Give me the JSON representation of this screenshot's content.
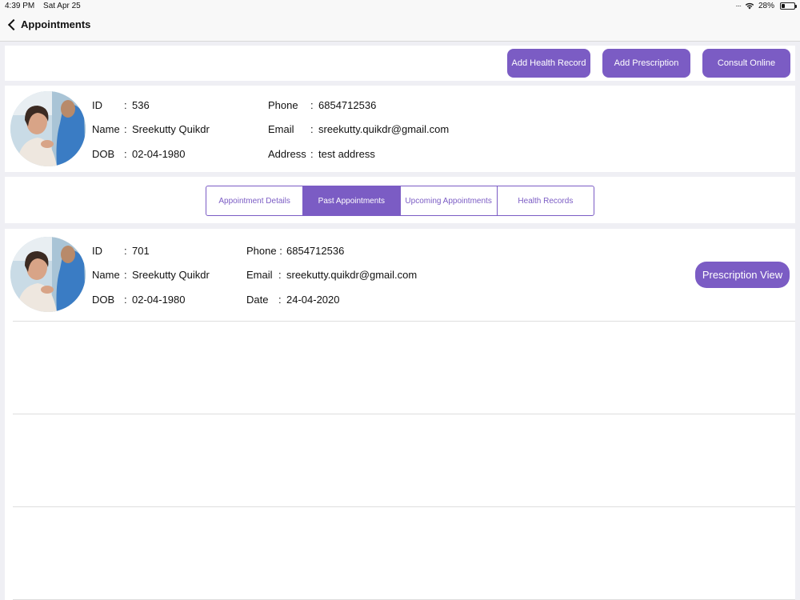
{
  "status_bar": {
    "time": "4:39 PM",
    "date": "Sat Apr 25",
    "battery": "28%",
    "battery_level": 0.28
  },
  "nav": {
    "back_label": "Appointments"
  },
  "actions": {
    "add_health_record": "Add Health Record",
    "add_prescription": "Add Prescription",
    "consult_online": "Consult Online"
  },
  "patient": {
    "id_label": "ID",
    "id_sep": ":",
    "id": "536",
    "name_label": "Name",
    "name_sep": ":",
    "name": "Sreekutty Quikdr",
    "dob_label": "DOB",
    "dob_sep": ":",
    "dob": "02-04-1980",
    "phone_label": "Phone",
    "phone_sep": ":",
    "phone": "6854712536",
    "email_label": "Email",
    "email_sep": ":",
    "email": "sreekutty.quikdr@gmail.com",
    "address_label": "Address",
    "address_sep": ":",
    "address": "test address"
  },
  "tabs": [
    {
      "label": "Appointment Details",
      "active": false
    },
    {
      "label": "Past Appointments",
      "active": true
    },
    {
      "label": "Upcoming Appointments",
      "active": false
    },
    {
      "label": "Health Records",
      "active": false
    }
  ],
  "appointments": [
    {
      "id_label": "ID",
      "id_sep": ":",
      "id": "701",
      "name_label": "Name",
      "name_sep": ":",
      "name": "Sreekutty Quikdr",
      "dob_label": "DOB",
      "dob_sep": ":",
      "dob": "02-04-1980",
      "phone_label": "Phone :",
      "phone": "6854712536",
      "email_label": "Email",
      "email_sep": ":",
      "email": "sreekutty.quikdr@gmail.com",
      "date_label": "Date",
      "date_sep": ":",
      "date": "24-04-2020",
      "prescription_view": "Prescription View"
    }
  ],
  "colors": {
    "accent": "#7b5cc4",
    "background": "#efeff4"
  }
}
